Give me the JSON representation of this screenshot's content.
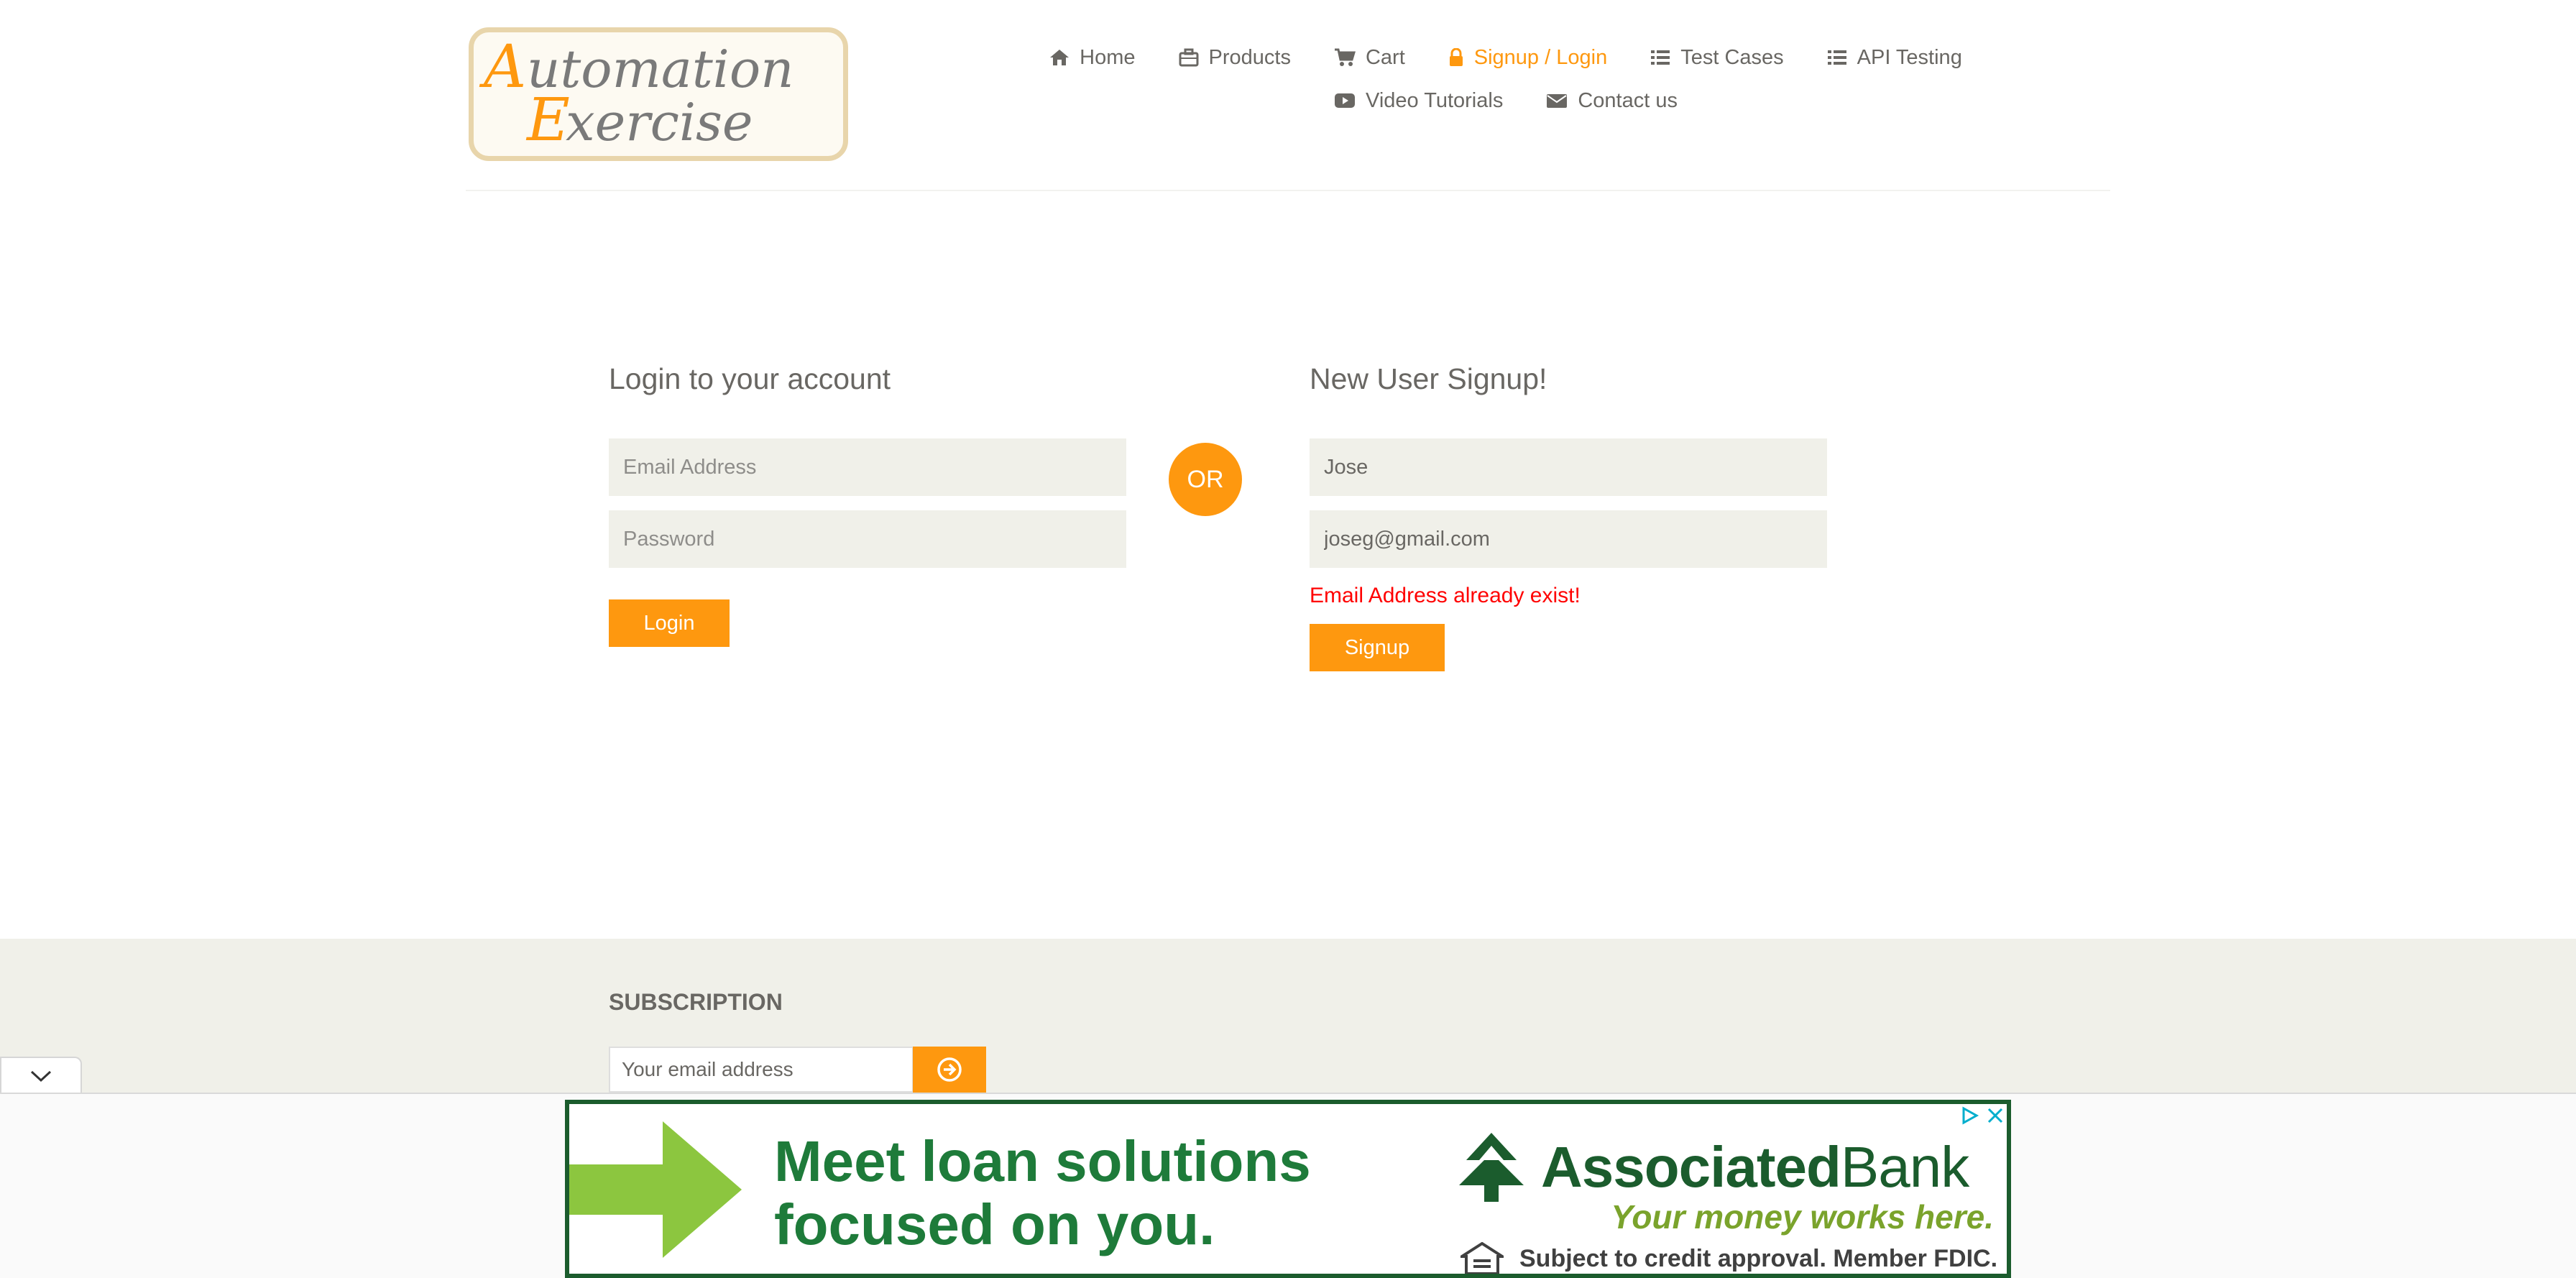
{
  "logo": {
    "line1": "Automation",
    "line2": "Exercise"
  },
  "nav": {
    "row1": [
      {
        "label": "Home",
        "icon": "home-icon"
      },
      {
        "label": "Products",
        "icon": "briefcase-icon"
      },
      {
        "label": "Cart",
        "icon": "cart-icon"
      },
      {
        "label": "Signup / Login",
        "icon": "lock-icon",
        "active": true
      },
      {
        "label": "Test Cases",
        "icon": "list-icon"
      },
      {
        "label": "API Testing",
        "icon": "list-icon"
      }
    ],
    "row2": [
      {
        "label": "Video Tutorials",
        "icon": "youtube-icon"
      },
      {
        "label": "Contact us",
        "icon": "envelope-icon"
      }
    ]
  },
  "login": {
    "title": "Login to your account",
    "email_placeholder": "Email Address",
    "password_placeholder": "Password",
    "button": "Login"
  },
  "divider": {
    "label": "OR"
  },
  "signup": {
    "title": "New User Signup!",
    "name_value": "Jose",
    "email_value": "joseg@gmail.com",
    "error": "Email Address already exist!",
    "button": "Signup"
  },
  "footer": {
    "subscription_title": "SUBSCRIPTION",
    "email_placeholder": "Your email address",
    "submit_icon": "arrow-circle-right-icon"
  },
  "ad": {
    "headline_line1": "Meet loan solutions",
    "headline_line2": "focused on you.",
    "brand_bold": "Associated",
    "brand_light": "Bank",
    "tagline": "Your money works here.",
    "fine_print": "Subject to credit approval. Member FDIC."
  },
  "colors": {
    "accent": "#fe980f",
    "text": "#696763",
    "field_bg": "#f0f0e9",
    "error": "#ff0000",
    "ad_green": "#1e7b3a"
  }
}
